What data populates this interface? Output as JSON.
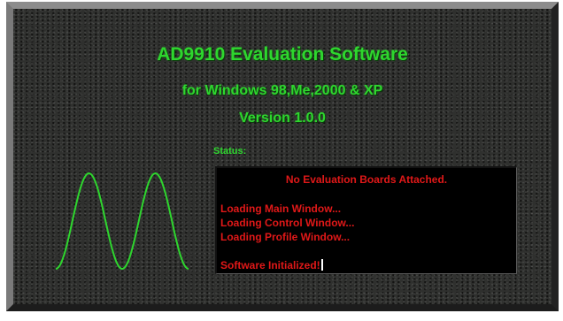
{
  "splash": {
    "title": "AD9910 Evaluation Software",
    "subtitle": "for Windows 98,Me,2000 & XP",
    "version": "Version 1.0.0"
  },
  "status": {
    "label": "Status:",
    "heading": "No Evaluation Boards Attached.",
    "lines": [
      "Loading Main Window...",
      "Loading Control Window...",
      "Loading Profile Window...",
      "Software Initialized!"
    ]
  },
  "graphic": {
    "icon": "waveform-icon",
    "color": "#2ed62e"
  },
  "colors": {
    "title": "#2ed62e",
    "status_text": "#e01818",
    "background": "#2f302e"
  }
}
